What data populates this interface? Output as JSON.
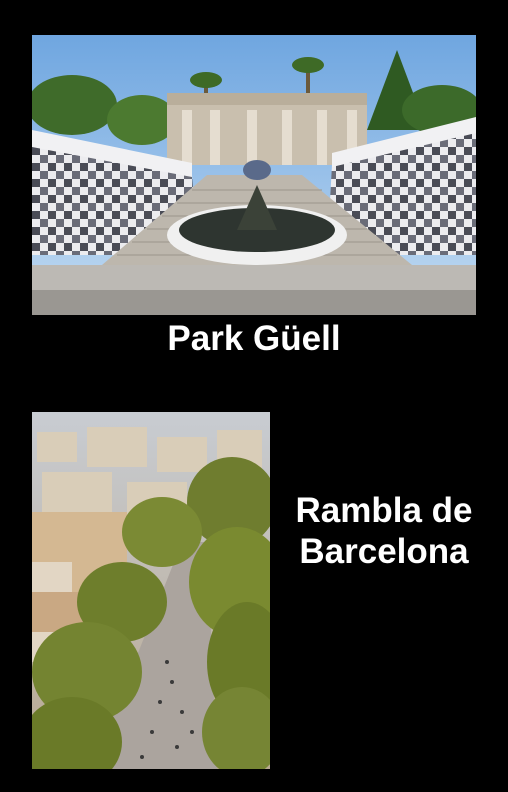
{
  "park": {
    "caption": "Park Güell",
    "image_subject": "park-guell-staircase-photo",
    "colors": {
      "sky": "#8fb9e6",
      "mosaic": "#e8e8ea",
      "stone": "#cfc6b6"
    }
  },
  "rambla": {
    "caption_line1": "Rambla de",
    "caption_line2": "Barcelona",
    "image_subject": "rambla-aerial-photo",
    "colors": {
      "trees": "#6a7a2a",
      "street": "#a8a09a",
      "buildings": "#c9b8a0"
    }
  },
  "background": "#000000"
}
